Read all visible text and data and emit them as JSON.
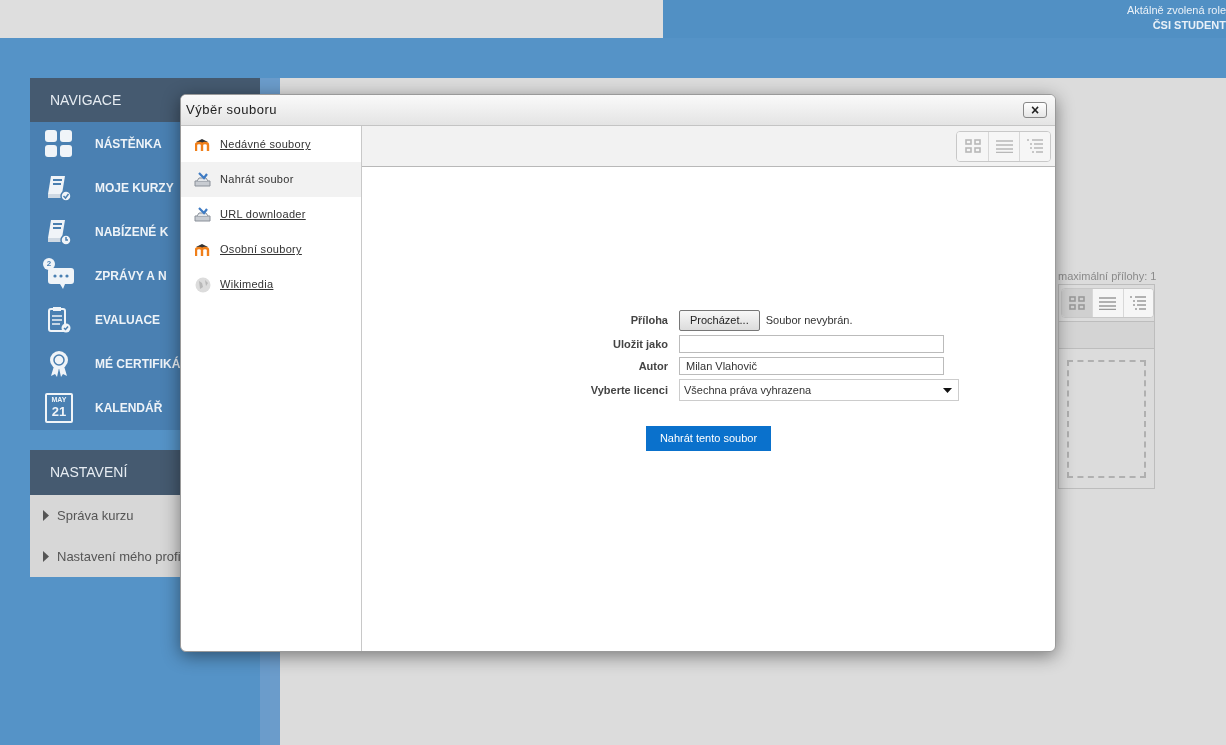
{
  "header": {
    "role_label": "Aktálně zvolená role",
    "role": "ČSI STUDENT"
  },
  "navigation": {
    "title": "NAVIGACE",
    "items": [
      {
        "label": "NÁSTĚNKA",
        "kind": "dashboard"
      },
      {
        "label": "MOJE KURZY",
        "kind": "book-check"
      },
      {
        "label": "NABÍZENÉ K",
        "kind": "book-clock"
      },
      {
        "label": "ZPRÁVY A N",
        "kind": "chat",
        "badge": "2"
      },
      {
        "label": "EVALUACE",
        "kind": "clipboard"
      },
      {
        "label": "MÉ CERTIFIKÁ",
        "kind": "rosette"
      },
      {
        "label": "KALENDÁŘ",
        "kind": "calendar",
        "month": "MAY",
        "day": "21"
      }
    ]
  },
  "settings": {
    "title": "NASTAVENÍ",
    "items": [
      {
        "label": "Správa kurzu"
      },
      {
        "label": "Nastavení mého profi"
      }
    ]
  },
  "file_manager": {
    "note": "maximální přílohy: 1",
    "views": [
      {
        "kind": "grid",
        "selected": true
      },
      {
        "kind": "list",
        "selected": false
      },
      {
        "kind": "tree",
        "selected": false
      }
    ]
  },
  "dialog": {
    "title": "Výběr souboru",
    "close": "×",
    "sources": [
      {
        "label": "Nedávné soubory",
        "kind": "moodle",
        "selected": false
      },
      {
        "label": "Nahrát soubor",
        "kind": "upload",
        "selected": true
      },
      {
        "label": "URL downloader",
        "kind": "upload",
        "selected": false
      },
      {
        "label": "Osobní soubory",
        "kind": "moodle",
        "selected": false
      },
      {
        "label": "Wikimedia",
        "kind": "globe",
        "selected": false
      }
    ],
    "views": [
      {
        "kind": "grid",
        "selected": false
      },
      {
        "kind": "list",
        "selected": false
      },
      {
        "kind": "tree",
        "selected": false
      }
    ],
    "form": {
      "attachment_label": "Příloha",
      "browse": "Procházet...",
      "no_file": "Soubor nevybrán.",
      "save_as_label": "Uložit jako",
      "author_label": "Autor",
      "author": "Milan Vlahovič",
      "license_label": "Vyberte licenci",
      "license": "Všechna práva vyhrazena",
      "submit": "Nahrát tento soubor"
    }
  }
}
